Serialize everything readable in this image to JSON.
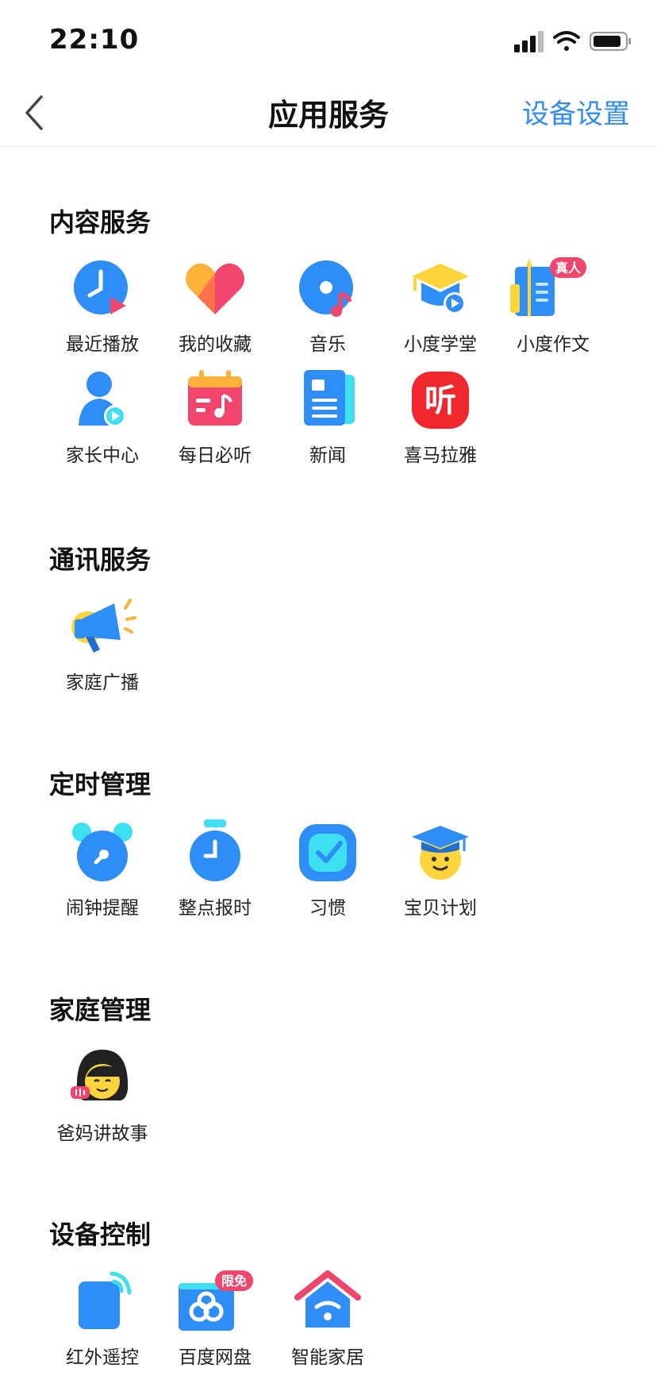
{
  "status_bar": {
    "time": "22:10"
  },
  "nav": {
    "title": "应用服务",
    "right_label": "设备设置"
  },
  "sections": [
    {
      "title": "内容服务",
      "items": [
        {
          "label": "最近播放",
          "icon": "recent-play-icon"
        },
        {
          "label": "我的收藏",
          "icon": "favorite-heart-icon"
        },
        {
          "label": "音乐",
          "icon": "music-disc-icon"
        },
        {
          "label": "小度学堂",
          "icon": "graduation-cap-icon"
        },
        {
          "label": "小度作文",
          "icon": "composition-book-icon",
          "badge": "真人"
        },
        {
          "label": "家长中心",
          "icon": "parent-center-icon"
        },
        {
          "label": "每日必听",
          "icon": "daily-listen-icon"
        },
        {
          "label": "新闻",
          "icon": "news-icon"
        },
        {
          "label": "喜马拉雅",
          "icon": "ximalaya-icon",
          "glyph": "听"
        }
      ]
    },
    {
      "title": "通讯服务",
      "items": [
        {
          "label": "家庭广播",
          "icon": "megaphone-icon"
        }
      ]
    },
    {
      "title": "定时管理",
      "items": [
        {
          "label": "闹钟提醒",
          "icon": "alarm-clock-icon"
        },
        {
          "label": "整点报时",
          "icon": "stopwatch-icon"
        },
        {
          "label": "习惯",
          "icon": "habit-check-icon"
        },
        {
          "label": "宝贝计划",
          "icon": "baby-plan-icon"
        }
      ]
    },
    {
      "title": "家庭管理",
      "items": [
        {
          "label": "爸妈讲故事",
          "icon": "parent-story-icon"
        }
      ]
    },
    {
      "title": "设备控制",
      "items": [
        {
          "label": "红外遥控",
          "icon": "infrared-remote-icon"
        },
        {
          "label": "百度网盘",
          "icon": "baidu-netdisk-icon",
          "badge": "限免"
        },
        {
          "label": "智能家居",
          "icon": "smart-home-icon"
        }
      ]
    }
  ],
  "colors": {
    "accent_blue": "#2f8ef5",
    "badge_pink": "#f2456b",
    "yellow": "#ffd43a",
    "cyan": "#3ee0f0"
  }
}
